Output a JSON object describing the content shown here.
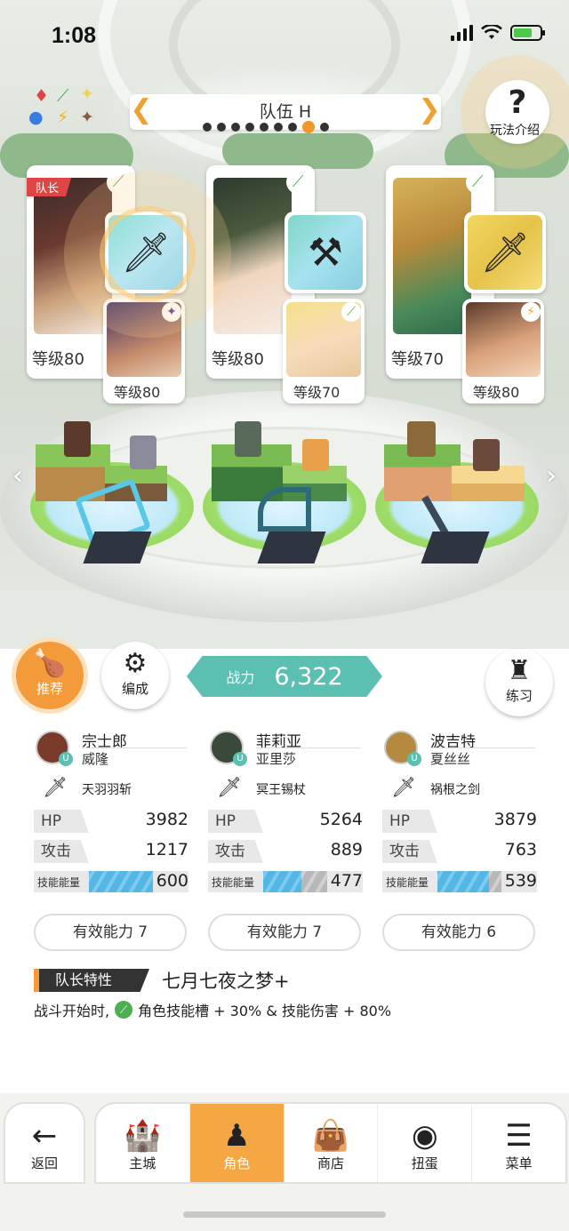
{
  "status": {
    "time": "1:08"
  },
  "header": {
    "team_name": "队伍 H",
    "prev_arrow": "❮",
    "next_arrow": "❯",
    "page_count": 9,
    "active_page": 8,
    "help_label": "玩法介绍",
    "help_glyph": "?"
  },
  "heroes": [
    {
      "captain_tag": "队长",
      "level": "等级80",
      "sub_level": "等级80",
      "weapon_icon": "sword-icon",
      "sub_element": "✦"
    },
    {
      "captain_tag": "",
      "level": "等级80",
      "sub_level": "等级70",
      "weapon_icon": "scythe-icon",
      "sub_element": "⟋"
    },
    {
      "captain_tag": "",
      "level": "等级70",
      "sub_level": "等级80",
      "weapon_icon": "dagger-icon",
      "sub_element": "⚡"
    }
  ],
  "actions": {
    "recommend": "推荐",
    "formation": "编成",
    "practice": "练习"
  },
  "power": {
    "label": "战力",
    "value": "6,322"
  },
  "columns": [
    {
      "hero": "宗士郎",
      "sub": "威隆",
      "weapon": "天羽羽斩",
      "hp_label": "HP",
      "hp": "3982",
      "atk_label": "攻击",
      "atk": "1217",
      "skill_label": "技能能量",
      "skill": "600",
      "skill_fill": 1.0,
      "ability": "有效能力 7",
      "avatar_color": "#7a3a2a"
    },
    {
      "hero": "菲莉亚",
      "sub": "亚里莎",
      "weapon": "冥王锡杖",
      "hp_label": "HP",
      "hp": "5264",
      "atk_label": "攻击",
      "atk": "889",
      "skill_label": "技能能量",
      "skill": "477",
      "skill_fill": 0.6,
      "ability": "有效能力 7",
      "avatar_color": "#3a4a3a"
    },
    {
      "hero": "波吉特",
      "sub": "夏丝丝",
      "weapon": "祸根之剑",
      "hp_label": "HP",
      "hp": "3879",
      "atk_label": "攻击",
      "atk": "763",
      "skill_label": "技能能量",
      "skill": "539",
      "skill_fill": 0.8,
      "ability": "有效能力 6",
      "avatar_color": "#b58a40"
    }
  ],
  "leader": {
    "tag": "队长特性",
    "title": "七月七夜之梦+",
    "desc_prefix": "战斗开始时,",
    "desc_rest": "角色技能槽 + 30% & 技能伤害 + 80%"
  },
  "nav": {
    "back": "返回",
    "tabs": [
      "主城",
      "角色",
      "商店",
      "扭蛋",
      "菜单"
    ],
    "active": "角色"
  },
  "colors": {
    "accent": "#f39a3a",
    "teal": "#5bbfb1",
    "skill_bar": "#54b6e3",
    "green": "#4caf50"
  }
}
